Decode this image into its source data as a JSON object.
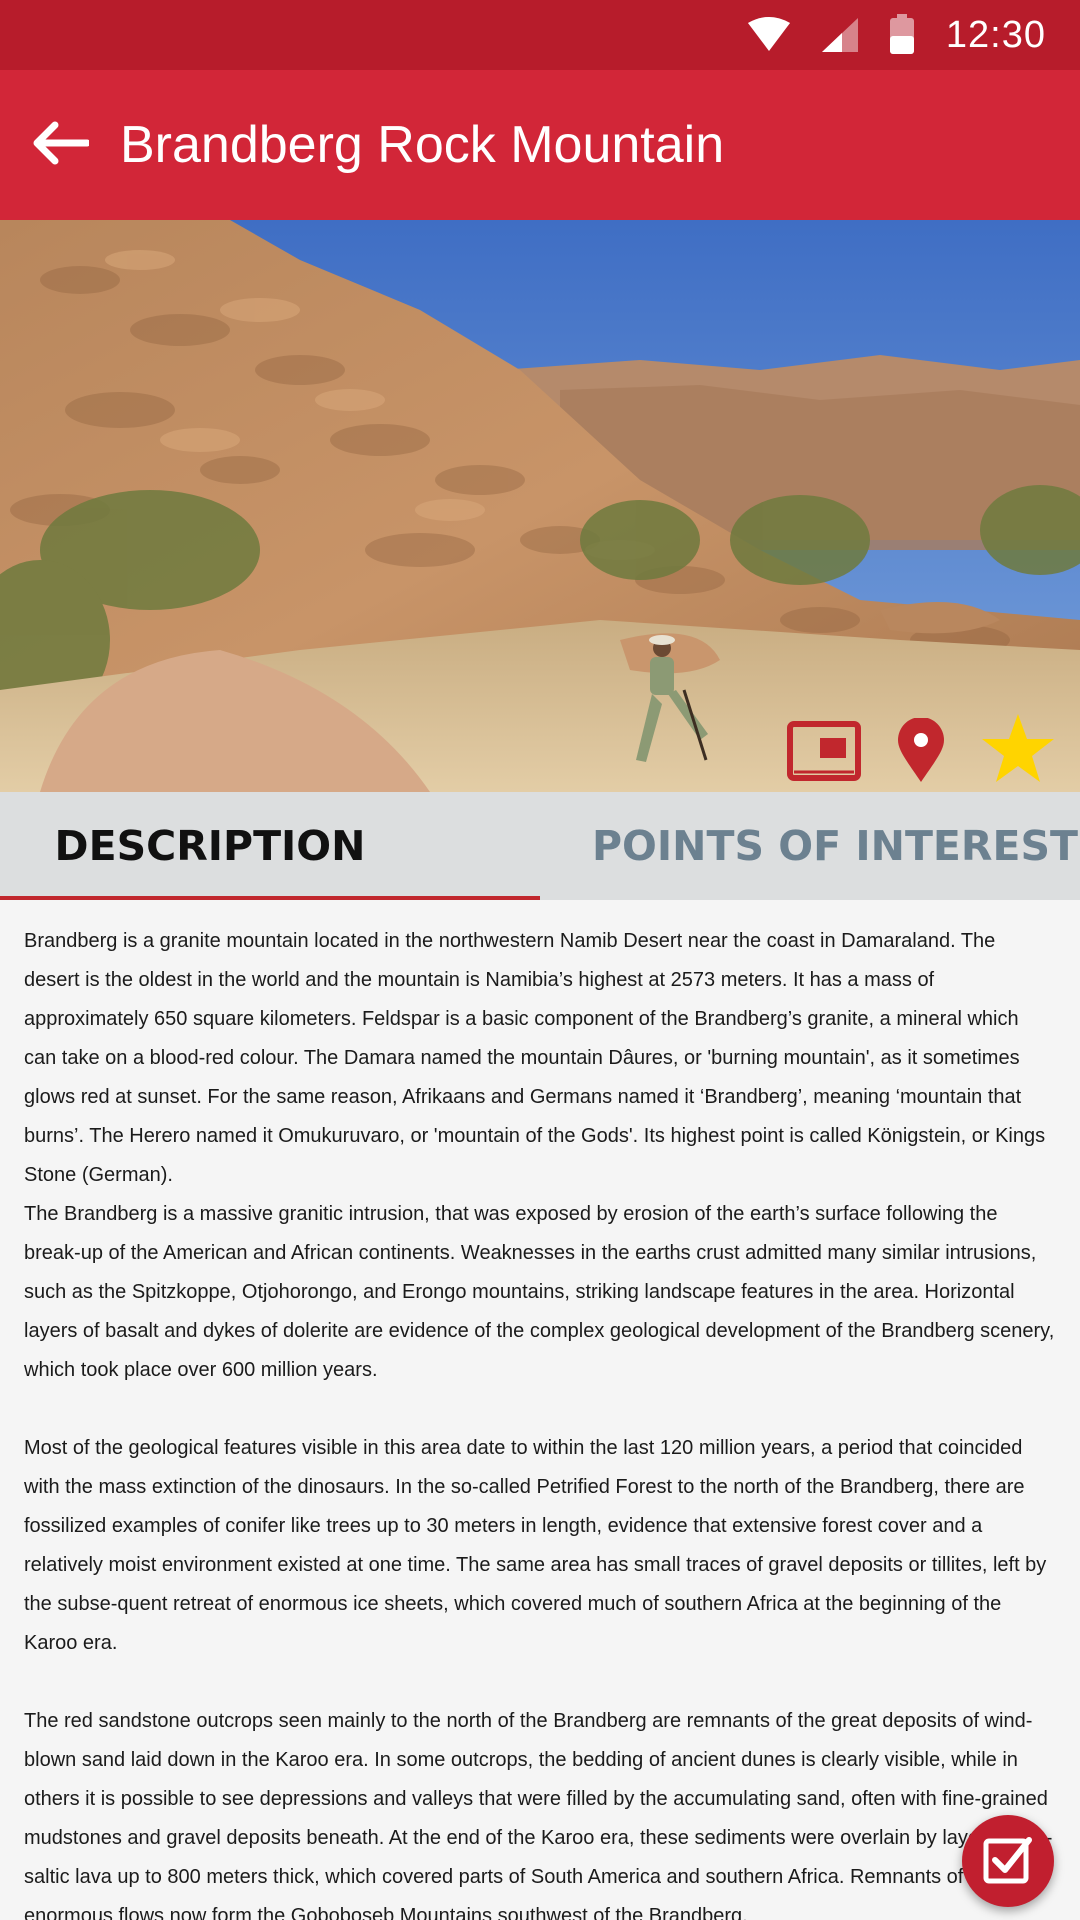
{
  "status_bar": {
    "time": "12:30",
    "icons": [
      "wifi-icon",
      "cell-signal-icon",
      "battery-icon"
    ]
  },
  "app_bar": {
    "title": "Brandberg Rock Mountain",
    "back_icon": "back-arrow-icon"
  },
  "hero": {
    "actions": [
      {
        "name": "gallery-icon"
      },
      {
        "name": "map-pin-icon"
      },
      {
        "name": "favorite-star-icon"
      }
    ]
  },
  "tabs": {
    "description": "DESCRIPTION",
    "points_of_interest": "POINTS OF INTEREST"
  },
  "content": {
    "p1": "Brandberg is a granite mountain located in the northwestern Namib Desert near the coast in Damaraland. The desert is the oldest in the world and the mountain is Namibia’s highest at 2573 meters. It has a mass of approximately 650 square kilometers. Feldspar is a basic component of the Brandberg’s granite, a mineral which can take on a blood-red colour. The Damara named the mountain Dâures, or 'burning mountain', as it sometimes glows red at sunset. For the same reason, Afrikaans and Germans named it ‘Brandberg’, meaning ‘mountain that burns’. The Herero named it Omukuruvaro, or 'mountain of the Gods'. Its highest point is called Königstein, or Kings Stone (German).",
    "p2": "The Brandberg is a massive granitic intrusion, that was exposed by erosion of the earth’s surface following the break-up of the American and African continents. Weaknesses in the earths crust admitted many similar intrusions, such as the Spitzkoppe, Otjohorongo, and Erongo mountains, striking landscape features in the area. Horizontal layers of basalt and dykes of dolerite are evidence of the complex geological development of the Brandberg scenery, which took place over 600 million years.",
    "p3": "Most of the geological features visible in this area date to within the last 120 million years, a period that coincided with the mass extinction of the dinosaurs. In the so-called Petrified Forest to the north of the Brandberg, there are fossilized examples of conifer like trees up to 30 meters in length, evidence that extensive forest cover and a relatively moist environment existed at one time. The same area has small traces of gravel deposits or tillites, left by the subse-quent retreat of enormous ice sheets, which covered much of southern Africa at the beginning of the Karoo era.",
    "p4": "The red sandstone outcrops seen mainly to the north of the Brandberg are remnants of the great deposits of wind-blown sand laid down in the Karoo era. In some outcrops, the bedding of ancient dunes is clearly visible, while in others it is possible to see depressions and valleys that were filled by the accumulating sand, often with fine-grained mudstones and gravel deposits beneath. At the end of the Karoo era, these sediments were overlain by layers of ba-saltic lava up to 800 meters thick, which covered parts of South America and southern Africa. Remnants of these enormous flows now form the Goboboseb Mountains southwest of the Brandberg."
  },
  "fab": {
    "icon": "checklist-icon"
  },
  "colors": {
    "status_bar": "#b71c2b",
    "app_bar": "#d22638",
    "accent": "#c1272d",
    "tab_inactive": "#6c8190",
    "star": "#ffd400"
  }
}
